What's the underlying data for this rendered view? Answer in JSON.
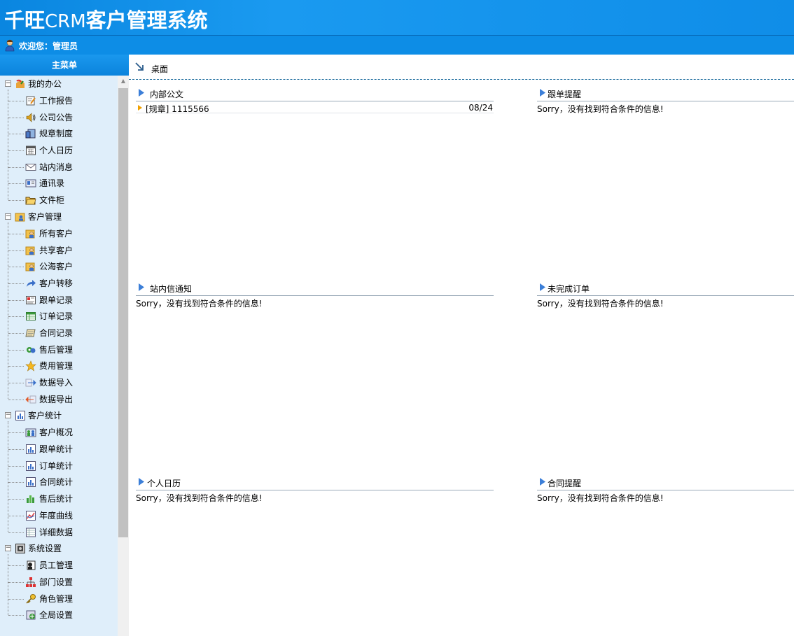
{
  "app": {
    "title_prefix": "千旺",
    "title_crm": "CRM",
    "title_suffix": "客户管理系统",
    "welcome": "欢迎您：管理员"
  },
  "sidebar": {
    "menu_title": "主菜单",
    "groups": [
      {
        "label": "我的办公",
        "icon": "office-icon",
        "items": [
          {
            "label": "工作报告",
            "icon": "report-edit-icon"
          },
          {
            "label": "公司公告",
            "icon": "speaker-icon"
          },
          {
            "label": "规章制度",
            "icon": "rules-icon"
          },
          {
            "label": "个人日历",
            "icon": "calendar-icon"
          },
          {
            "label": "站内消息",
            "icon": "envelope-icon"
          },
          {
            "label": "通讯录",
            "icon": "address-card-icon"
          },
          {
            "label": "文件柜",
            "icon": "folder-icon"
          }
        ]
      },
      {
        "label": "客户管理",
        "icon": "customer-folder-icon",
        "items": [
          {
            "label": "所有客户",
            "icon": "customer-icon"
          },
          {
            "label": "共享客户",
            "icon": "customer-icon"
          },
          {
            "label": "公海客户",
            "icon": "customer-icon"
          },
          {
            "label": "客户转移",
            "icon": "transfer-arrow-icon"
          },
          {
            "label": "跟单记录",
            "icon": "record-card-icon"
          },
          {
            "label": "订单记录",
            "icon": "order-table-icon"
          },
          {
            "label": "合同记录",
            "icon": "contract-icon"
          },
          {
            "label": "售后管理",
            "icon": "service-icon"
          },
          {
            "label": "费用管理",
            "icon": "star-icon"
          },
          {
            "label": "数据导入",
            "icon": "import-arrow-icon"
          },
          {
            "label": "数据导出",
            "icon": "export-arrow-icon"
          }
        ]
      },
      {
        "label": "客户统计",
        "icon": "stats-icon",
        "items": [
          {
            "label": "客户概况",
            "icon": "overview-icon"
          },
          {
            "label": "跟单统计",
            "icon": "bar-chart-icon"
          },
          {
            "label": "订单统计",
            "icon": "bar-chart-icon"
          },
          {
            "label": "合同统计",
            "icon": "bar-chart-icon"
          },
          {
            "label": "售后统计",
            "icon": "green-chart-icon"
          },
          {
            "label": "年度曲线",
            "icon": "line-chart-icon"
          },
          {
            "label": "详细数据",
            "icon": "data-table-icon"
          }
        ]
      },
      {
        "label": "系统设置",
        "icon": "settings-icon",
        "items": [
          {
            "label": "员工管理",
            "icon": "staff-icon"
          },
          {
            "label": "部门设置",
            "icon": "org-chart-icon"
          },
          {
            "label": "角色管理",
            "icon": "key-icon"
          },
          {
            "label": "全局设置",
            "icon": "global-settings-icon"
          }
        ]
      }
    ]
  },
  "desktop": {
    "label": "桌面",
    "panels": {
      "docs": {
        "title": "内部公文",
        "rows": [
          {
            "title": "[规章] 1115566",
            "date": "08/24"
          }
        ]
      },
      "followup": {
        "title": "跟单提醒",
        "empty": "Sorry，没有找到符合条件的信息!"
      },
      "messages": {
        "title": "站内信通知",
        "empty": "Sorry，没有找到符合条件的信息!"
      },
      "orders": {
        "title": "未完成订单",
        "empty": "Sorry，没有找到符合条件的信息!"
      },
      "calendar": {
        "title": "个人日历",
        "empty": "Sorry，没有找到符合条件的信息!"
      },
      "contracts": {
        "title": "合同提醒",
        "empty": "Sorry，没有找到符合条件的信息!"
      }
    }
  },
  "colors": {
    "header_blue": "#0a86e0",
    "sidebar_bg": "#dfeefa",
    "triangle_blue": "#3c7fd8",
    "bullet_orange": "#f0a000"
  }
}
